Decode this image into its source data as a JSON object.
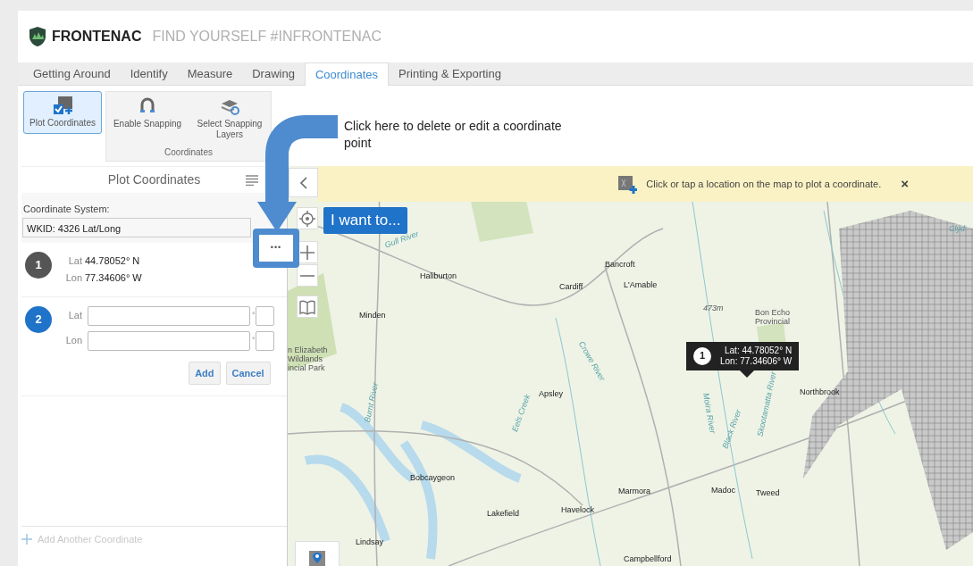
{
  "header": {
    "brand": "FRONTENAC",
    "tagline": "FIND YOURSELF #INFRONTENAC"
  },
  "tabs": [
    {
      "label": "Getting Around",
      "selected": false
    },
    {
      "label": "Identify",
      "selected": false
    },
    {
      "label": "Measure",
      "selected": false
    },
    {
      "label": "Drawing",
      "selected": false
    },
    {
      "label": "Coordinates",
      "selected": true
    },
    {
      "label": "Printing & Exporting",
      "selected": false
    }
  ],
  "ribbon": {
    "tools": [
      {
        "kind": "plot",
        "label": "Plot Coordinates",
        "selected": true
      },
      {
        "kind": "snap",
        "label": "Enable Snapping",
        "selected": false
      },
      {
        "kind": "layers",
        "label": "Select Snapping Layers",
        "selected": false
      }
    ],
    "group_label": "Coordinates"
  },
  "callout": {
    "text": "Click here to delete or edit a coordinate point",
    "more_button": "•••"
  },
  "panel": {
    "title": "Plot Coordinates",
    "coordinate_system_label": "Coordinate System:",
    "coordinate_system": "WKID: 4326 Lat/Long",
    "points": [
      {
        "kind": "plotted",
        "number": "1",
        "lat_label": "Lat",
        "lat": "44.78052° N",
        "lon_label": "Lon",
        "lon": "77.34606° W"
      },
      {
        "kind": "editing",
        "number": "2",
        "lat_label": "Lat",
        "lat_degree": "°",
        "lon_label": "Lon",
        "lon_degree": "°"
      }
    ],
    "buttons": [
      "Add",
      "Cancel"
    ],
    "add_another": "Add Another Coordinate"
  },
  "map": {
    "banner": "Click or tap a location on the map to plot a coordinate.",
    "banner_close": "×",
    "i_want_to": "I want to...",
    "marker": {
      "number": "1",
      "lat": "Lat: 44.78052° N",
      "lon": "Lon: 77.34606° W"
    },
    "places": [
      {
        "kind": "river",
        "name": "Clyd"
      },
      {
        "kind": "river",
        "name": "Gull River"
      },
      {
        "kind": "town",
        "name": "Bancroft"
      },
      {
        "kind": "town",
        "name": "Haliburton"
      },
      {
        "kind": "town",
        "name": "Cardiff"
      },
      {
        "kind": "town",
        "name": "L'Amable"
      },
      {
        "kind": "town",
        "name": "Minden"
      },
      {
        "kind": "elevation",
        "name": "473m"
      },
      {
        "kind": "park",
        "name": "Bon Echo Provincial"
      },
      {
        "kind": "park",
        "name": "n Elizabeth Wildlands incial Park"
      },
      {
        "kind": "river",
        "name": "Burnt River"
      },
      {
        "kind": "river",
        "name": "Eels Creek"
      },
      {
        "kind": "town",
        "name": "Apsley"
      },
      {
        "kind": "river",
        "name": "Crowe River"
      },
      {
        "kind": "river",
        "name": "Moira River"
      },
      {
        "kind": "river",
        "name": "Black River"
      },
      {
        "kind": "river",
        "name": "Skootamatta River"
      },
      {
        "kind": "town",
        "name": "Northbrook"
      },
      {
        "kind": "town",
        "name": "Bobcaygeon"
      },
      {
        "kind": "town",
        "name": "Marmora"
      },
      {
        "kind": "town",
        "name": "Madoc"
      },
      {
        "kind": "town",
        "name": "Tweed"
      },
      {
        "kind": "town",
        "name": "Lakefield"
      },
      {
        "kind": "town",
        "name": "Havelock"
      },
      {
        "kind": "town",
        "name": "Lindsay"
      },
      {
        "kind": "town",
        "name": "Campbellford"
      }
    ]
  }
}
